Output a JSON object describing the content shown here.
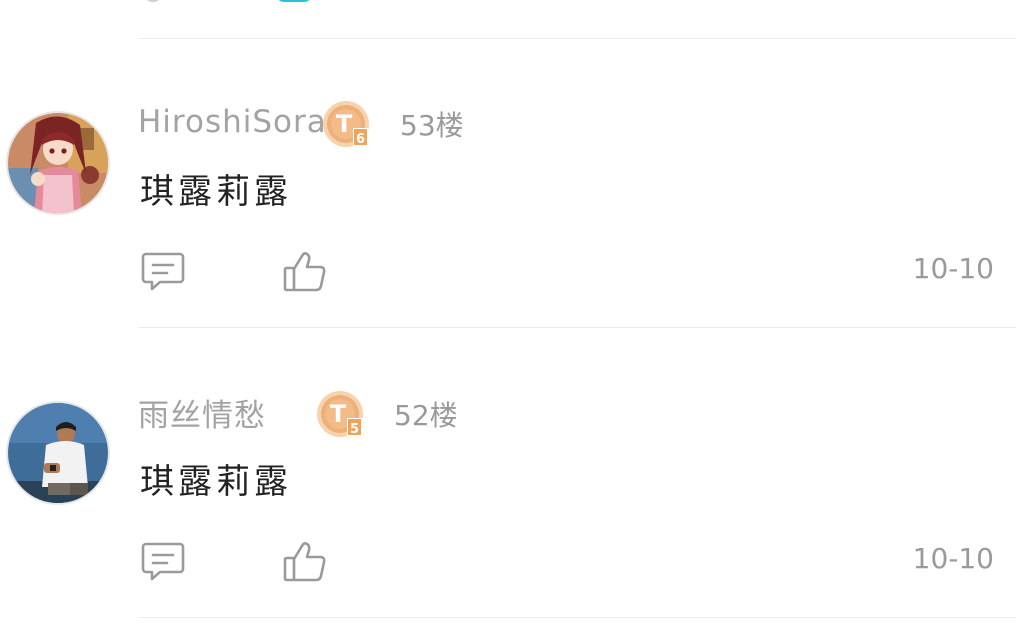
{
  "colors": {
    "username": "#a3a3a3",
    "content": "#222222",
    "meta": "#9a9a9a",
    "divider": "#ececec",
    "badge_gold": "#f0b57a",
    "accent_cyan": "#29c4d3"
  },
  "comments": [
    {
      "username": "HiroshiSora",
      "level_letter": "T",
      "level_number": "6",
      "floor": "53楼",
      "content": "琪露莉露",
      "date": "10-10",
      "icons": {
        "reply": "comment-icon",
        "like": "thumbs-up-icon"
      }
    },
    {
      "username": "雨丝情愁",
      "level_letter": "T",
      "level_number": "5",
      "floor": "52楼",
      "content": "琪露莉露",
      "date": "10-10",
      "icons": {
        "reply": "comment-icon",
        "like": "thumbs-up-icon"
      }
    }
  ]
}
